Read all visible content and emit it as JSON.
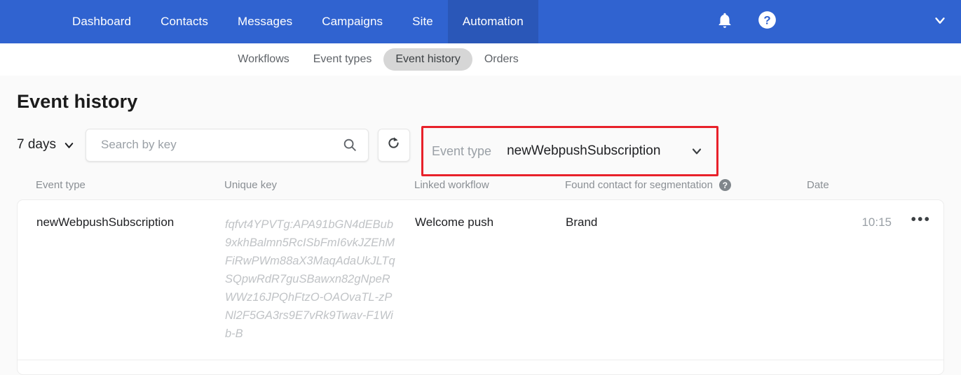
{
  "topnav": {
    "items": [
      {
        "label": "Dashboard",
        "active": false
      },
      {
        "label": "Contacts",
        "active": false
      },
      {
        "label": "Messages",
        "active": false
      },
      {
        "label": "Campaigns",
        "active": false
      },
      {
        "label": "Site",
        "active": false
      },
      {
        "label": "Automation",
        "active": true
      }
    ],
    "icons": {
      "notifications": "bell-icon",
      "help": "help-circle-icon",
      "account_menu": "chevron-down-icon"
    },
    "background_color": "#3063d0",
    "active_color": "#2a57b8"
  },
  "subnav": {
    "items": [
      {
        "label": "Workflows",
        "active": false
      },
      {
        "label": "Event types",
        "active": false
      },
      {
        "label": "Event history",
        "active": true
      },
      {
        "label": "Orders",
        "active": false
      }
    ]
  },
  "page": {
    "title": "Event history"
  },
  "controls": {
    "period_label": "7 days",
    "search": {
      "placeholder": "Search by key",
      "value": ""
    },
    "refresh_icon": "refresh-icon",
    "event_type_filter": {
      "label": "Event type",
      "value": "newWebpushSubscription",
      "highlight_color": "#e8212a"
    }
  },
  "table": {
    "columns": [
      "Event type",
      "Unique key",
      "Linked workflow",
      "Found contact for segmentation",
      "Date"
    ],
    "found_contact_help": "?",
    "rows": [
      {
        "event_type": "newWebpushSubscription",
        "unique_key": "fqfvt4YPVTg:APA91bGN4dEBub9xkhBalmn5RcISbFmI6vkJZEhMFiRwPWm88aX3MaqAdaUkJLTqSQpwRdR7guSBawxn82gNpeRWWz16JPQhFtzO-OAOvaTL-zPNl2F5GA3rs9E7vRk9Twav-F1Wib-B",
        "linked_workflow": "Welcome push",
        "found_contact": "Brand",
        "date": "10:15",
        "actions_icon": "more-options-icon"
      }
    ]
  }
}
